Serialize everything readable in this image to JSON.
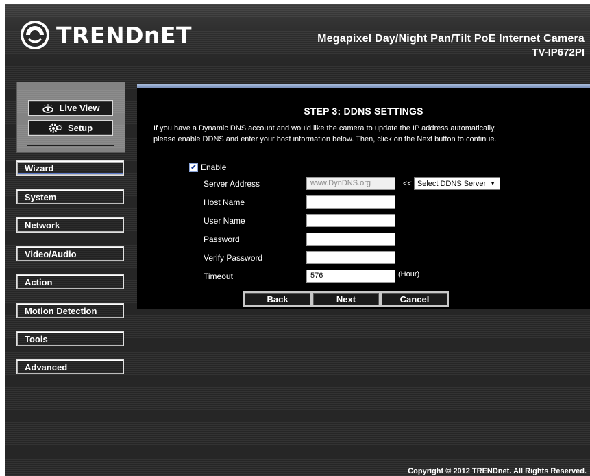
{
  "header": {
    "brand": "TRENDnET",
    "product_name": "Megapixel Day/Night Pan/Tilt PoE Internet Camera",
    "model": "TV-IP672PI"
  },
  "sidebar": {
    "mode_buttons": [
      {
        "label": "Live View",
        "icon": "eye-icon"
      },
      {
        "label": "Setup",
        "icon": "gear-icon"
      }
    ],
    "items": [
      {
        "label": "Wizard",
        "active": true
      },
      {
        "label": "System"
      },
      {
        "label": "Network"
      },
      {
        "label": "Video/Audio"
      },
      {
        "label": "Action"
      },
      {
        "label": "Motion Detection"
      },
      {
        "label": "Tools"
      },
      {
        "label": "Advanced"
      }
    ]
  },
  "wizard": {
    "title": "STEP 3: DDNS SETTINGS",
    "description_line1": "If you have a Dynamic DNS account and would like the camera to update the IP address automatically,",
    "description_line2": "please enable DDNS and enter your host information below. Then, click on the Next button to continue.",
    "enable_label": "Enable",
    "enable_checked": true,
    "fields": {
      "server_address": {
        "label": "Server Address",
        "value": "www.DynDNS.org"
      },
      "host_name": {
        "label": "Host Name",
        "value": ""
      },
      "user_name": {
        "label": "User Name",
        "value": ""
      },
      "password": {
        "label": "Password",
        "value": ""
      },
      "verify_password": {
        "label": "Verify Password",
        "value": ""
      },
      "timeout": {
        "label": "Timeout",
        "value": "576",
        "unit": "(Hour)"
      }
    },
    "server_select_prefix": "<<",
    "server_select_value": "Select DDNS Server",
    "buttons": {
      "back": "Back",
      "next": "Next",
      "cancel": "Cancel"
    }
  },
  "footer": {
    "copyright": "Copyright © 2012 TRENDnet. All Rights Reserved."
  },
  "colors": {
    "panel_bar": "#8aa0c8",
    "active_underline": "#5a78c8"
  }
}
